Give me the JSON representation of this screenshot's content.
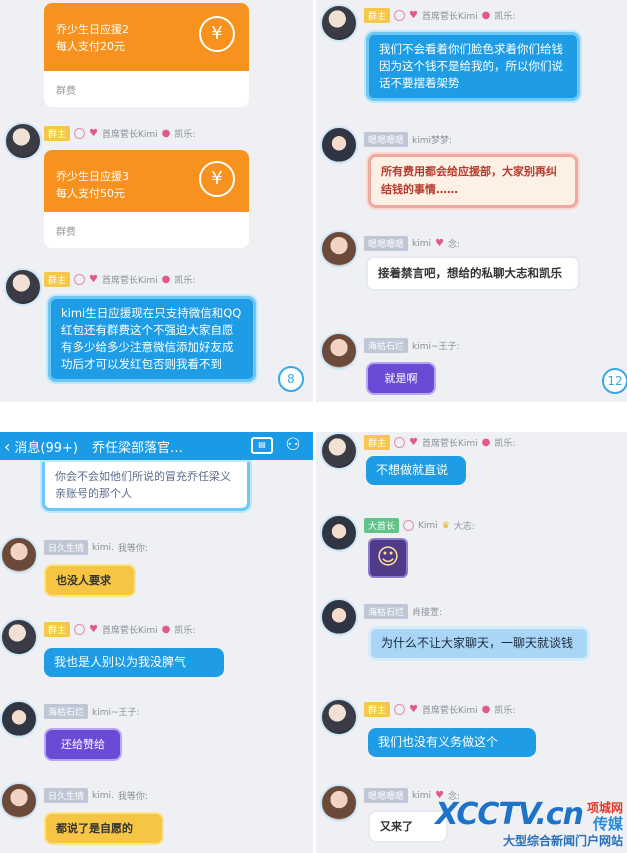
{
  "panel1": {
    "card1": {
      "title": "乔少生日应援2",
      "desc": "每人支付20元",
      "footer": "群费"
    },
    "msg1": {
      "tag": "群主",
      "name": "首席菅长Kimi",
      "name2": "凯乐:"
    },
    "card2": {
      "title": "乔少生日应援3",
      "desc": "每人支付50元",
      "footer": "群费"
    },
    "msg2": {
      "tag": "群主",
      "name": "首席菅长Kimi",
      "name2": "凯乐:",
      "text": "kimi生日应援现在只支持微信和QQ红包还有群费这个不强迫大家自愿有多少给多少注意微信添加好友成功后才可以发红包否则我看不到"
    },
    "count": "8"
  },
  "panel2": {
    "msg1": {
      "tag": "群主",
      "name": "首席菅长Kimi",
      "name2": "凯乐:",
      "text": "我们不会看着你们脸色求着你们给钱因为这个钱不是给我的，所以你们说话不要摆着架势"
    },
    "msg2": {
      "tag": "嗯嗯嗯嗯",
      "name": "kimi梦梦:",
      "text": "所有费用都会给应援部，大家别再纠结钱的事情……"
    },
    "msg3": {
      "tag": "嗯嗯嗯嗯",
      "name": "kimi",
      "name2": "念:",
      "text": "接着禁言吧，想给的私聊大志和凯乐"
    },
    "msg4": {
      "tag": "海枯石烂",
      "name": "kimi~王子:",
      "text": "就是啊"
    },
    "count": "12"
  },
  "panel3": {
    "nav": {
      "back": "‹",
      "unread": "消息(99+)",
      "title": "乔任梁部落官…",
      "icon1": "卡片",
      "icon2": "people-icon"
    },
    "msg0": {
      "text": "你会不会如他们所说的冒充乔任梁义亲账号的那个人"
    },
    "msg1": {
      "tag": "日久生情",
      "name": "kimi.",
      "name2": "我等你:",
      "text": "也没人要求"
    },
    "msg2": {
      "tag": "群主",
      "name": "首席菅长Kimi",
      "name2": "凯乐:",
      "text": "我也是人别以为我没脾气"
    },
    "msg3": {
      "tag": "海枯石烂",
      "name": "kimi~王子:",
      "text": "还给赞给"
    },
    "msg4": {
      "tag": "日久生情",
      "name": "kimi.",
      "name2": "我等你:",
      "text": "都说了是自愿的"
    }
  },
  "panel4": {
    "msg1": {
      "tag": "群主",
      "name": "首席菅长Kimi",
      "name2": "凯乐:",
      "text": "不想做就直说"
    },
    "msg2": {
      "tag": "大首长",
      "name": "Kimi",
      "name2": "大志:"
    },
    "msg3": {
      "tag": "海枯石烂",
      "name": "肖接萱:",
      "text": "为什么不让大家聊天，一聊天就谈钱"
    },
    "msg4": {
      "tag": "群主",
      "name": "首席菅长Kimi",
      "name2": "凯乐:",
      "text": "我们也没有义务做这个"
    },
    "msg5": {
      "tag": "嗯嗯嗯嗯",
      "name": "kimi",
      "name2": "念:",
      "text": "又来了"
    }
  },
  "watermark": {
    "brand": "XCCTV.cn",
    "cn1": "项城网",
    "cn2": "传媒",
    "slogan": "大型综合新闻门户网站"
  }
}
